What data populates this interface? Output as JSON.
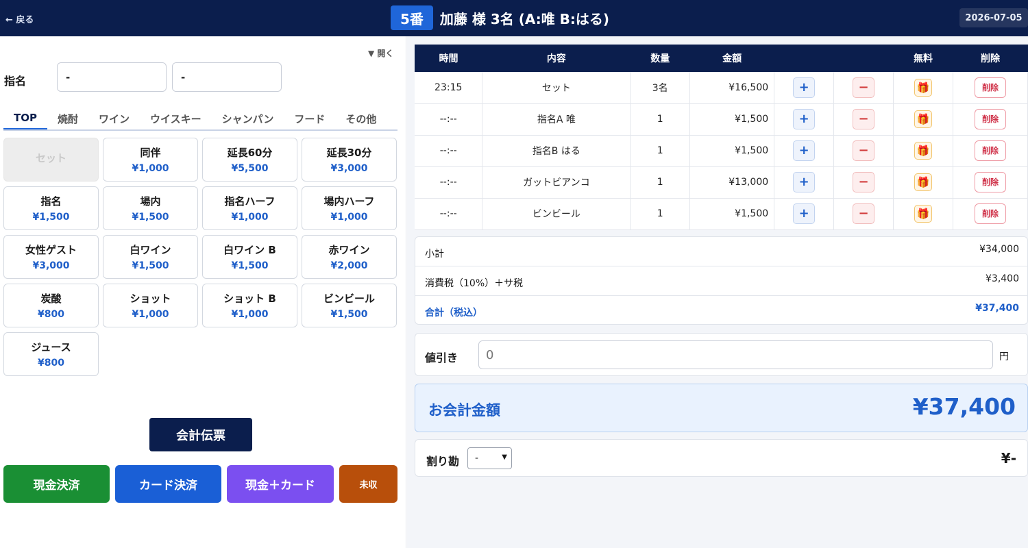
{
  "header": {
    "back_label": "← 戻る",
    "table_badge": "5番",
    "title": "加藤 様 3名 (A:唯 B:はる)",
    "date": "2026-07-05"
  },
  "left": {
    "open_toggle": "▼ 開く",
    "shimei_label": "指名",
    "shimei_a_value": "-",
    "shimei_b_value": "-",
    "tabs": [
      "TOP",
      "焼酎",
      "ワイン",
      "ウイスキー",
      "シャンパン",
      "フード",
      "その他"
    ],
    "items": [
      {
        "name": "セット",
        "price": "",
        "disabled": true
      },
      {
        "name": "同伴",
        "price": "¥1,000"
      },
      {
        "name": "延長60分",
        "price": "¥5,500"
      },
      {
        "name": "延長30分",
        "price": "¥3,000"
      },
      {
        "name": "指名",
        "price": "¥1,500"
      },
      {
        "name": "場内",
        "price": "¥1,500"
      },
      {
        "name": "指名ハーフ",
        "price": "¥1,000"
      },
      {
        "name": "場内ハーフ",
        "price": "¥1,000"
      },
      {
        "name": "女性ゲスト",
        "price": "¥3,000"
      },
      {
        "name": "白ワイン",
        "price": "¥1,500"
      },
      {
        "name": "白ワイン B",
        "price": "¥1,500"
      },
      {
        "name": "赤ワイン",
        "price": "¥2,000"
      },
      {
        "name": "炭酸",
        "price": "¥800"
      },
      {
        "name": "ショット",
        "price": "¥1,000"
      },
      {
        "name": "ショット B",
        "price": "¥1,000"
      },
      {
        "name": "ビンビール",
        "price": "¥1,500"
      },
      {
        "name": "ジュース",
        "price": "¥800"
      }
    ],
    "slip_button": "会計伝票",
    "pay_buttons": {
      "cash": "現金決済",
      "card": "カード決済",
      "mixed": "現金＋カード",
      "unpaid": "未収"
    }
  },
  "orders": {
    "columns": {
      "time": "時間",
      "content": "内容",
      "qty": "数量",
      "amount": "金額",
      "free": "無料",
      "delete": "削除"
    },
    "plus_label": "+",
    "minus_label": "−",
    "gift_icon": "🎁",
    "delete_label": "削除",
    "rows": [
      {
        "time": "23:15",
        "content": "セット",
        "qty": "3名",
        "amount": "¥16,500"
      },
      {
        "time": "--:--",
        "content": "指名A 唯",
        "qty": "1",
        "amount": "¥1,500"
      },
      {
        "time": "--:--",
        "content": "指名B はる",
        "qty": "1",
        "amount": "¥1,500"
      },
      {
        "time": "--:--",
        "content": "ガットビアンコ",
        "qty": "1",
        "amount": "¥13,000"
      },
      {
        "time": "--:--",
        "content": "ビンビール",
        "qty": "1",
        "amount": "¥1,500"
      }
    ]
  },
  "summary": {
    "subtotal_label": "小計",
    "subtotal": "¥34,000",
    "tax_label": "消費税（10%）＋サ税",
    "tax": "¥3,400",
    "total_label": "合計（税込）",
    "total": "¥37,400"
  },
  "discount": {
    "label": "値引き",
    "value": "0",
    "unit": "円"
  },
  "payment": {
    "label": "お会計金額",
    "amount": "¥37,400"
  },
  "split": {
    "label": "割り勘",
    "selected": "-",
    "value": "¥-"
  },
  "colors": {
    "navy": "#0b1e4d",
    "accent_blue": "#1f66d9",
    "cash_green": "#1a8f34",
    "card_blue": "#1a5fd6",
    "mixed_purple": "#7b4ff0",
    "unpaid_brown": "#b84f0b"
  }
}
